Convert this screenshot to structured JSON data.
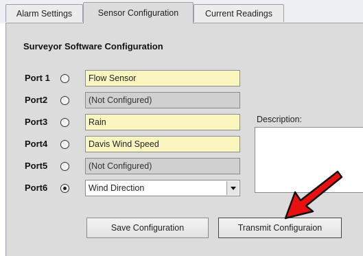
{
  "tabs": [
    {
      "label": "Alarm Settings",
      "active": false
    },
    {
      "label": "Sensor Configuration",
      "active": true
    },
    {
      "label": "Current Readings",
      "active": false
    }
  ],
  "section_title": "Surveyor Software Configuration",
  "ports": [
    {
      "label": "Port 1",
      "value": "Flow Sensor",
      "state": "editable",
      "selected": false
    },
    {
      "label": "Port2",
      "value": "(Not Configured)",
      "state": "disabled",
      "selected": false
    },
    {
      "label": "Port3",
      "value": "Rain",
      "state": "editable",
      "selected": false
    },
    {
      "label": "Port4",
      "value": "Davis Wind Speed",
      "state": "editable",
      "selected": false
    },
    {
      "label": "Port5",
      "value": "(Not Configured)",
      "state": "disabled",
      "selected": false
    },
    {
      "label": "Port6",
      "value": "Wind Direction",
      "state": "dropdown",
      "selected": true
    }
  ],
  "description_label": "Description:",
  "buttons": {
    "save": "Save Configuration",
    "transmit": "Transmit Configuraion"
  },
  "colors": {
    "panel": "#dcdcdc",
    "field_editable": "#fbf5c0",
    "field_disabled": "#d0d0d0",
    "arrow": "#e81010"
  }
}
